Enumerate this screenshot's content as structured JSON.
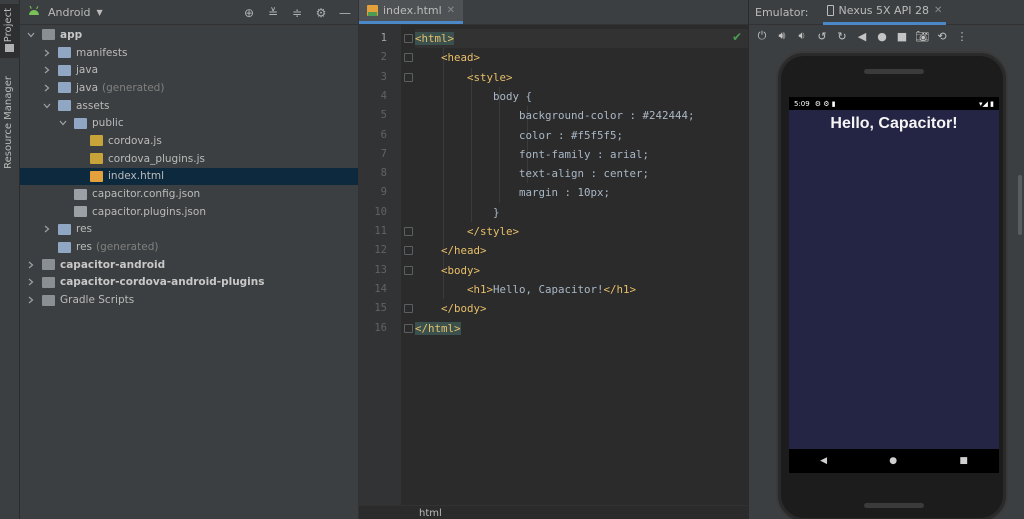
{
  "toolstrip": {
    "project_label": "Project",
    "resource_manager_label": "Resource Manager"
  },
  "project": {
    "view_title": "Android",
    "tree": [
      {
        "label": "app",
        "depth": 0,
        "expanded": true,
        "icon": "module-folder-icon",
        "bold": true
      },
      {
        "label": "manifests",
        "depth": 1,
        "expanded": false,
        "icon": "folder-icon"
      },
      {
        "label": "java",
        "depth": 1,
        "expanded": false,
        "icon": "folder-icon"
      },
      {
        "label": "java",
        "suffix": "(generated)",
        "depth": 1,
        "expanded": false,
        "icon": "generated-folder-icon"
      },
      {
        "label": "assets",
        "depth": 1,
        "expanded": true,
        "icon": "folder-icon"
      },
      {
        "label": "public",
        "depth": 2,
        "expanded": true,
        "icon": "folder-icon"
      },
      {
        "label": "cordova.js",
        "depth": 3,
        "leaf": true,
        "icon": "js-file-icon"
      },
      {
        "label": "cordova_plugins.js",
        "depth": 3,
        "leaf": true,
        "icon": "js-file-icon"
      },
      {
        "label": "index.html",
        "depth": 3,
        "leaf": true,
        "icon": "html-file-icon",
        "selected": true
      },
      {
        "label": "capacitor.config.json",
        "depth": 2,
        "leaf": true,
        "icon": "json-file-icon"
      },
      {
        "label": "capacitor.plugins.json",
        "depth": 2,
        "leaf": true,
        "icon": "json-file-icon"
      },
      {
        "label": "res",
        "depth": 1,
        "expanded": false,
        "icon": "res-folder-icon"
      },
      {
        "label": "res",
        "suffix": "(generated)",
        "depth": 1,
        "leaf": true,
        "icon": "res-folder-icon"
      },
      {
        "label": "capacitor-android",
        "depth": 0,
        "expanded": false,
        "icon": "module-folder-icon",
        "bold": true
      },
      {
        "label": "capacitor-cordova-android-plugins",
        "depth": 0,
        "expanded": false,
        "icon": "module-folder-icon",
        "bold": true
      },
      {
        "label": "Gradle Scripts",
        "depth": 0,
        "expanded": false,
        "icon": "gradle-icon"
      }
    ]
  },
  "editor": {
    "tab_label": "index.html",
    "current_line": 1,
    "lines": [
      [
        "<html>"
      ],
      [
        "    ",
        "<head>"
      ],
      [
        "        ",
        "<style>"
      ],
      [
        "            body {"
      ],
      [
        "                background-color : #242444;"
      ],
      [
        "                color : #f5f5f5;"
      ],
      [
        "                font-family : arial;"
      ],
      [
        "                text-align : center;"
      ],
      [
        "                margin : 10px;"
      ],
      [
        "            }"
      ],
      [
        "        ",
        "</style>"
      ],
      [
        "    ",
        "</head>"
      ],
      [
        "    ",
        "<body>"
      ],
      [
        "        ",
        "<h1>",
        "Hello, Capacitor!",
        "</h1>"
      ],
      [
        "    ",
        "</body>"
      ],
      [
        "</html>"
      ]
    ],
    "breadcrumb": "html"
  },
  "emulator": {
    "panel_label": "Emulator:",
    "device_tab": "Nexus 5X API 28",
    "status_time": "5:09",
    "app_heading": "Hello, Capacitor!",
    "screen_bg": "#242444",
    "nav": [
      "◀",
      "●",
      "■"
    ]
  },
  "colors": {
    "ide_bg": "#2b2b2b",
    "panel_bg": "#3c3f41",
    "tag": "#e8bf6a",
    "selection": "#0d293e",
    "accent": "#4a88c7"
  }
}
